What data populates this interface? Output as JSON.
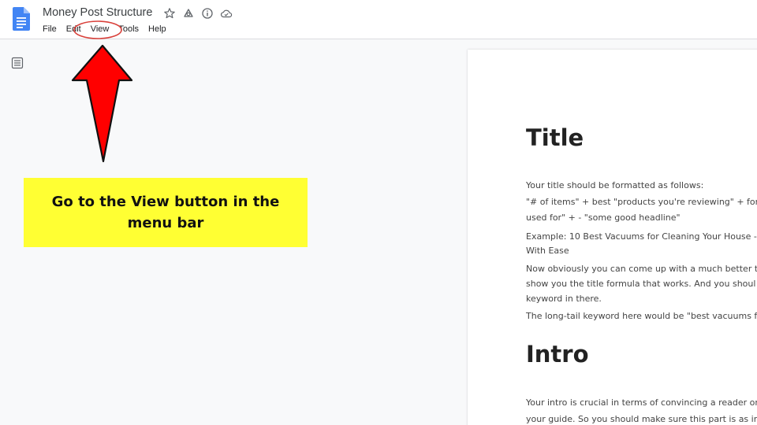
{
  "doc": {
    "title": "Money Post Structure"
  },
  "menu": [
    "File",
    "Edit",
    "View",
    "Tools",
    "Help"
  ],
  "icons": {
    "logo": "google-docs-icon",
    "star": "star-icon",
    "move": "move-to-drive-icon",
    "info": "info-icon",
    "cloud": "cloud-status-icon",
    "outline": "document-outline-icon"
  },
  "annotation": {
    "callout_text": "Go to the View button in the menu bar",
    "arrow_color": "#ff0000",
    "highlight_color": "#ffff33"
  },
  "content": {
    "title_heading": "Title",
    "title_lines": [
      "Your title should be formatted as follows:",
      "\"# of items\" + best \"products you're reviewing\" + for",
      "used for\" + - \"some good headline\"",
      "Example: 10 Best Vacuums for Cleaning Your House -",
      "With Ease",
      "Now obviously you can come up with a much better ti",
      "show you the title formula that works. And you shoul",
      "keyword in there.",
      "The long-tail keyword here would be \"best vacuums fo"
    ],
    "intro_heading": "Intro",
    "intro_lines": [
      "Your intro is crucial in terms of convincing a reader on",
      "your guide. So you should make sure this part is as in"
    ]
  }
}
